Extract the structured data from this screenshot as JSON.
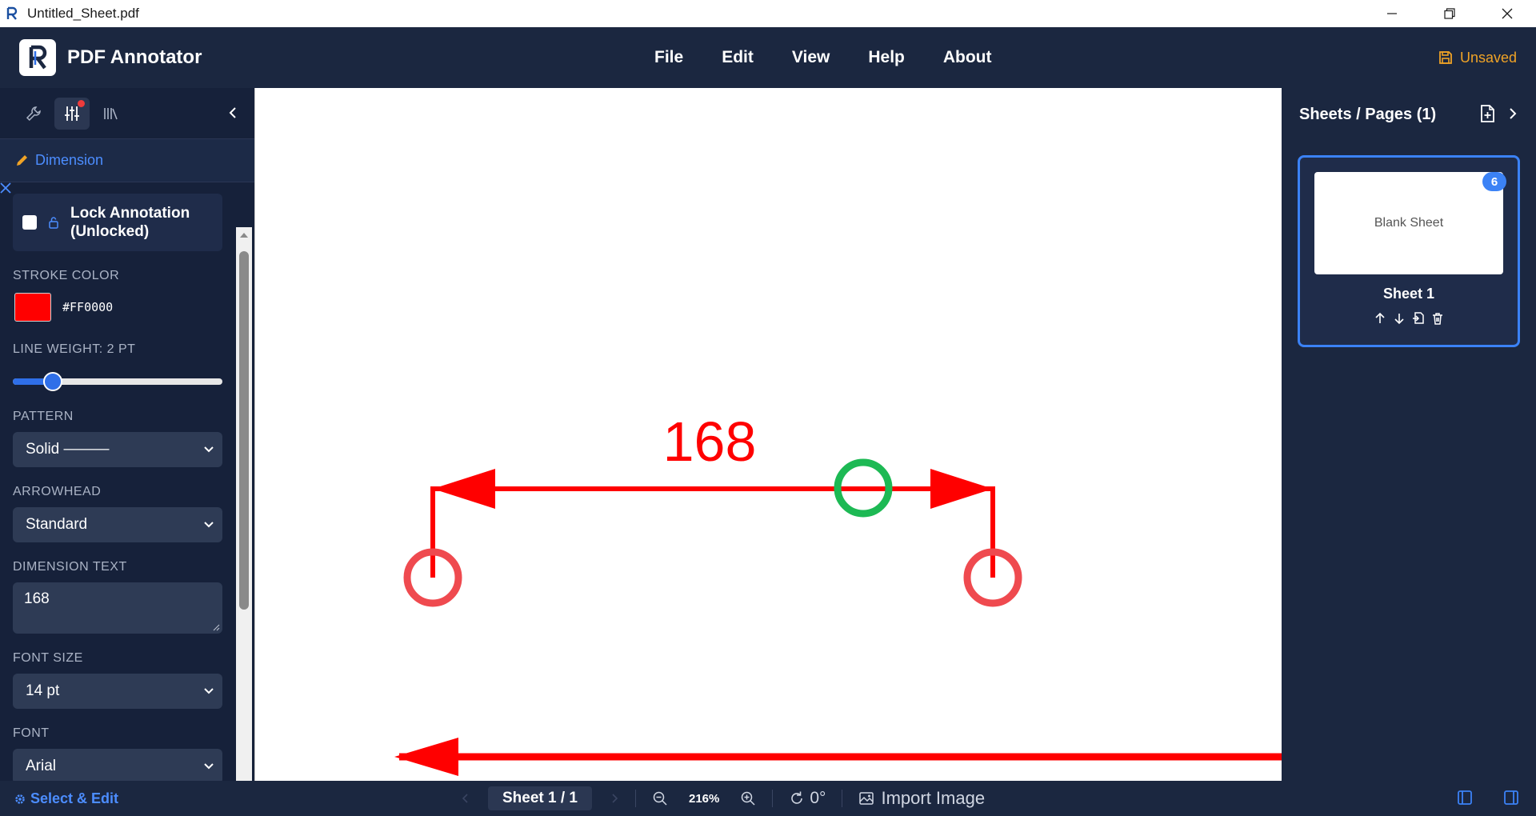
{
  "window": {
    "title": "Untitled_Sheet.pdf"
  },
  "app": {
    "name": "PDF Annotator",
    "status": "Unsaved"
  },
  "menu": [
    {
      "label": "File"
    },
    {
      "label": "Edit"
    },
    {
      "label": "View"
    },
    {
      "label": "Help"
    },
    {
      "label": "About"
    }
  ],
  "left_panel": {
    "tool_title": "Dimension",
    "lock_label": "Lock Annotation",
    "lock_state": "(Unlocked)",
    "lock_checked": false,
    "stroke_color_label": "STROKE COLOR",
    "stroke_color": "#FF0000",
    "line_weight_label": "LINE WEIGHT: 2 PT",
    "line_weight_fraction": 0.16,
    "pattern_label": "PATTERN",
    "pattern_value": "Solid ———",
    "arrowhead_label": "ARROWHEAD",
    "arrowhead_value": "Standard",
    "dimension_text_label": "DIMENSION TEXT",
    "dimension_text_value": "168",
    "font_size_label": "FONT SIZE",
    "font_size_value": "14 pt",
    "font_label": "FONT",
    "font_value": "Arial"
  },
  "canvas": {
    "dimension_text": "168",
    "line_color": "#ff0000",
    "handle_color": "#ef4a4f",
    "midpoint_handle_color": "#1db954"
  },
  "right_panel": {
    "title": "Sheets / Pages (1)",
    "sheet": {
      "thumbnail_text": "Blank Sheet",
      "badge": "6",
      "name": "Sheet 1"
    }
  },
  "statusbar": {
    "mode": "Select & Edit",
    "sheet_indicator": "Sheet 1 / 1",
    "zoom": "216%",
    "rotation": "0°",
    "import": "Import Image"
  },
  "colors": {
    "accent": "#3b82f6",
    "header_bg": "#1b2740",
    "panel_bg": "#16213a",
    "unsaved": "#f0a326"
  }
}
